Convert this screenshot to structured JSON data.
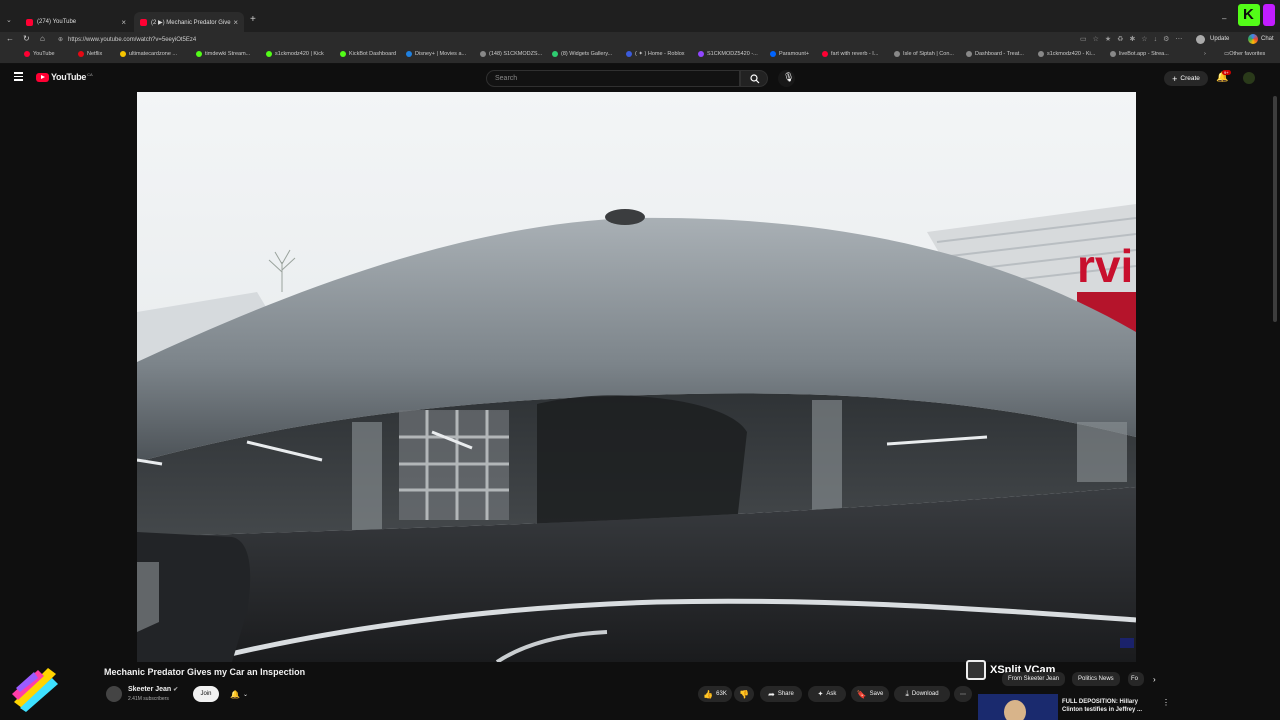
{
  "browser": {
    "tabs": [
      {
        "label": "(274) YouTube"
      },
      {
        "label": "(2 ▶) Mechanic Predator Give"
      }
    ],
    "url": "https://www.youtube.com/watch?v=5eeyiOt5Ez4",
    "update_label": "Update",
    "chat_label": "Chat",
    "bookmarks": [
      {
        "label": "YouTube",
        "color": "#ff0033"
      },
      {
        "label": "Netflix",
        "color": "#e50914"
      },
      {
        "label": "ultimatecardzone ...",
        "color": "#f5c400"
      },
      {
        "label": "timdewki Stream...",
        "color": "#53fc18"
      },
      {
        "label": "s1ckmodz420 | Kick",
        "color": "#53fc18"
      },
      {
        "label": "KickBot Dashboard",
        "color": "#53fc18"
      },
      {
        "label": "Disney+ | Movies a...",
        "color": "#1f80e0"
      },
      {
        "label": "(148) S1CKMODZS...",
        "color": "#888888"
      },
      {
        "label": "(8) Widgets Gallery...",
        "color": "#2ecc71"
      },
      {
        "label": "( ✦ ) Home - Roblox",
        "color": "#3b5bdb"
      },
      {
        "label": "S1CKMODZ5420 -...",
        "color": "#9146ff"
      },
      {
        "label": "Paramount+",
        "color": "#0064ff"
      },
      {
        "label": "fart with reverb - I...",
        "color": "#ff0033"
      },
      {
        "label": "Isle of Siptah | Con...",
        "color": "#888888"
      },
      {
        "label": "Dashboard - Treat...",
        "color": "#888888"
      },
      {
        "label": "s1ckmodz420 - Ki...",
        "color": "#888888"
      },
      {
        "label": "liveBot.app - Strea...",
        "color": "#888888"
      }
    ],
    "other_favorites": "Other favorites"
  },
  "youtube": {
    "logo_text": "YouTube",
    "logo_badge": "CA",
    "search_placeholder": "Search",
    "create_label": "Create",
    "notification_count": "9+",
    "video": {
      "title": "Mechanic Predator Gives my Car an Inspection",
      "channel": "Skeeter Jean",
      "subscribers": "2.41M subscribers",
      "join_label": "Join",
      "likes": "63K",
      "share_label": "Share",
      "ask_label": "Ask",
      "save_label": "Save",
      "download_label": "Download"
    },
    "chips": [
      {
        "label": "From Skeeter Jean"
      },
      {
        "label": "Politics News"
      },
      {
        "label": "Fo"
      }
    ],
    "recommended": {
      "title_line1": "FULL DEPOSITION: Hillary",
      "title_line2": "Clinton testifies in Jeffrey ..."
    },
    "overlay_text": "XSplit VCam"
  },
  "colors": {
    "youtube_red": "#ff0033",
    "kick_green": "#53fc18",
    "bg": "#0f0f0f"
  }
}
